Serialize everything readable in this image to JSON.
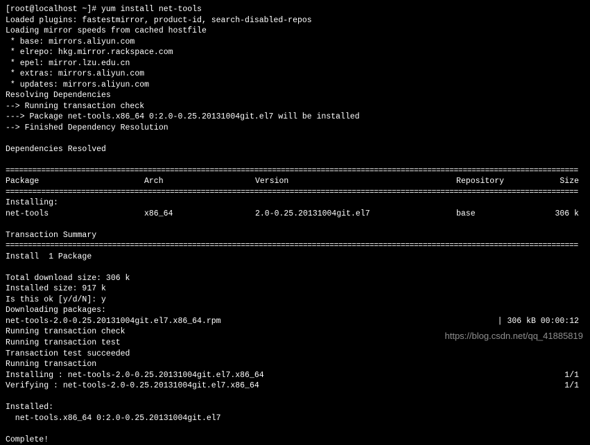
{
  "prompt": "[root@localhost ~]# yum install net-tools",
  "plugins": "Loaded plugins: fastestmirror, product-id, search-disabled-repos",
  "loading_mirrors": "Loading mirror speeds from cached hostfile",
  "mirrors": {
    "base": " * base: mirrors.aliyun.com",
    "elrepo": " * elrepo: hkg.mirror.rackspace.com",
    "epel": " * epel: mirror.lzu.edu.cn",
    "extras": " * extras: mirrors.aliyun.com",
    "updates": " * updates: mirrors.aliyun.com"
  },
  "resolving": "Resolving Dependencies",
  "trans_check": "--> Running transaction check",
  "pkg_install": "---> Package net-tools.x86_64 0:2.0-0.25.20131004git.el7 will be installed",
  "finished_dep": "--> Finished Dependency Resolution",
  "deps_resolved": "Dependencies Resolved",
  "headers": {
    "package": " Package",
    "arch": "Arch",
    "version": "Version",
    "repo": "Repository",
    "size": "Size"
  },
  "installing_label": "Installing:",
  "row": {
    "package": " net-tools",
    "arch": "x86_64",
    "version": "2.0-0.25.20131004git.el7",
    "repo": "base",
    "size": "306 k"
  },
  "trans_summary": "Transaction Summary",
  "install_count": "Install  1 Package",
  "total_dl": "Total download size: 306 k",
  "installed_size": "Installed size: 917 k",
  "confirm": "Is this ok [y/d/N]: y",
  "downloading": "Downloading packages:",
  "dl_file": "net-tools-2.0-0.25.20131004git.el7.x86_64.rpm",
  "dl_status": "| 306 kB  00:00:12",
  "run_check": "Running transaction check",
  "run_test": "Running transaction test",
  "test_succ": "Transaction test succeeded",
  "run_trans": "Running transaction",
  "installing_pkg": "  Installing : net-tools-2.0-0.25.20131004git.el7.x86_64",
  "verifying_pkg": "  Verifying  : net-tools-2.0-0.25.20131004git.el7.x86_64",
  "progress": "1/1",
  "installed_label": "Installed:",
  "installed_pkg": "  net-tools.x86_64 0:2.0-0.25.20131004git.el7",
  "complete": "Complete!",
  "watermark": "https://blog.csdn.net/qq_41885819",
  "divider": "================================================================================================================================="
}
